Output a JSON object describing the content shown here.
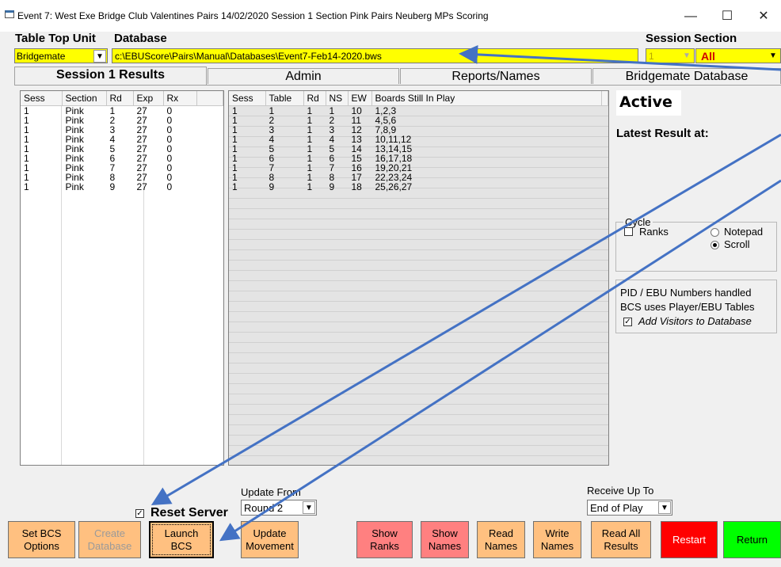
{
  "window": {
    "title": "Event 7: West Exe Bridge Club Valentines Pairs 14/02/2020 Session 1 Section Pink Pairs Neuberg MPs Scoring",
    "minimize": "—",
    "maximize": "☐",
    "close": "✕"
  },
  "top": {
    "table_top_label": "Table Top Unit",
    "database_label": "Database",
    "table_top_value": "Bridgemate",
    "database_value": "c:\\EBUScore\\Pairs\\Manual\\Databases\\Event7-Feb14-2020.bws",
    "session_label": "Session",
    "section_label": "Section",
    "session_value": "1",
    "section_value": "All"
  },
  "tabs": [
    "Session 1 Results",
    "Admin",
    "Reports/Names",
    "Bridgemate Database"
  ],
  "left_grid": {
    "columns": [
      "Sess",
      "Section",
      "Rd",
      "Exp",
      "Rx"
    ],
    "rows": [
      [
        "1",
        "Pink",
        "1",
        "27",
        "0"
      ],
      [
        "1",
        "Pink",
        "2",
        "27",
        "0"
      ],
      [
        "1",
        "Pink",
        "3",
        "27",
        "0"
      ],
      [
        "1",
        "Pink",
        "4",
        "27",
        "0"
      ],
      [
        "1",
        "Pink",
        "5",
        "27",
        "0"
      ],
      [
        "1",
        "Pink",
        "6",
        "27",
        "0"
      ],
      [
        "1",
        "Pink",
        "7",
        "27",
        "0"
      ],
      [
        "1",
        "Pink",
        "8",
        "27",
        "0"
      ],
      [
        "1",
        "Pink",
        "9",
        "27",
        "0"
      ]
    ]
  },
  "right_grid": {
    "columns": [
      "Sess",
      "Table",
      "Rd",
      "NS",
      "EW",
      "Boards Still In Play"
    ],
    "rows": [
      [
        "1",
        "1",
        "1",
        "1",
        "10",
        "1,2,3"
      ],
      [
        "1",
        "2",
        "1",
        "2",
        "11",
        "4,5,6"
      ],
      [
        "1",
        "3",
        "1",
        "3",
        "12",
        "7,8,9"
      ],
      [
        "1",
        "4",
        "1",
        "4",
        "13",
        "10,11,12"
      ],
      [
        "1",
        "5",
        "1",
        "5",
        "14",
        "13,14,15"
      ],
      [
        "1",
        "6",
        "1",
        "6",
        "15",
        "16,17,18"
      ],
      [
        "1",
        "7",
        "1",
        "7",
        "16",
        "19,20,21"
      ],
      [
        "1",
        "8",
        "1",
        "8",
        "17",
        "22,23,24"
      ],
      [
        "1",
        "9",
        "1",
        "9",
        "18",
        "25,26,27"
      ]
    ]
  },
  "status": {
    "active": "Active",
    "latest_result": "Latest Result at:"
  },
  "cycle": {
    "label": "Cycle",
    "ranks": "Ranks",
    "notepad": "Notepad",
    "scroll": "Scroll"
  },
  "pid": {
    "line1": "PID / EBU Numbers handled",
    "line2": "BCS uses Player/EBU Tables",
    "add_visitors": "Add Visitors to Database"
  },
  "bottom": {
    "reset_server": "Reset Server",
    "update_from_label": "Update From",
    "update_from_value": "Round 2",
    "receive_label": "Receive Up To",
    "receive_value": "End of Play",
    "buttons": {
      "set_bcs": [
        "Set BCS",
        "Options"
      ],
      "create_db": [
        "Create",
        "Database"
      ],
      "launch_bcs": [
        "Launch",
        "BCS"
      ],
      "update_movement": [
        "Update",
        "Movement"
      ],
      "show_ranks": [
        "Show",
        "Ranks"
      ],
      "show_names": [
        "Show",
        "Names"
      ],
      "read_names": [
        "Read",
        "Names"
      ],
      "write_names": [
        "Write",
        "Names"
      ],
      "read_all": [
        "Read All",
        "Results"
      ],
      "restart": "Restart",
      "return": "Return"
    }
  },
  "colors": {
    "yellow": "#ffff00",
    "orange": "#ffc080",
    "pink": "#ff8080",
    "red": "#ff0000",
    "green": "#00ff00",
    "arrow": "#4472c4"
  }
}
